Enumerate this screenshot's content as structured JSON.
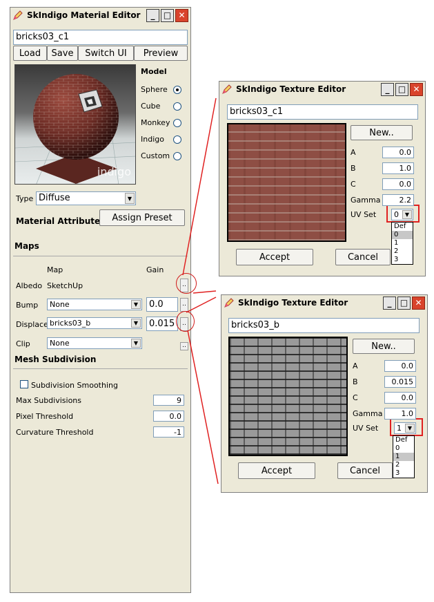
{
  "material_editor": {
    "title": "SkIndigo Material Editor",
    "material_name": "bricks03_c1",
    "buttons": {
      "load": "Load",
      "save": "Save",
      "switch_ui": "Switch UI",
      "preview": "Preview"
    },
    "preview_caption": "indigo",
    "model": {
      "heading": "Model",
      "options": [
        "Sphere",
        "Cube",
        "Monkey",
        "Indigo",
        "Custom"
      ],
      "selected": "Sphere"
    },
    "type_label": "Type",
    "type_value": "Diffuse",
    "material_attributes": "Material Attributes",
    "assign_preset": "Assign Preset",
    "maps": {
      "heading": "Maps",
      "col_map": "Map",
      "col_gain": "Gain",
      "rows": [
        {
          "label": "Albedo",
          "map": "SketchUp",
          "gain": ""
        },
        {
          "label": "Bump",
          "map": "None",
          "gain": "0.0"
        },
        {
          "label": "Displace",
          "map": "bricks03_b",
          "gain": "0.015"
        },
        {
          "label": "Clip",
          "map": "None",
          "gain": ""
        }
      ],
      "dots": ".."
    },
    "mesh_subdivision": {
      "heading": "Mesh Subdivision",
      "smoothing_label": "Subdivision Smoothing",
      "smoothing_checked": false,
      "fields": [
        {
          "label": "Max Subdivisions",
          "value": "9"
        },
        {
          "label": "Pixel Threshold",
          "value": "0.0"
        },
        {
          "label": "Curvature Threshold",
          "value": "-1"
        }
      ]
    }
  },
  "texture_editors": [
    {
      "title": "SkIndigo Texture Editor",
      "name": "bricks03_c1",
      "new_button": "New..",
      "fields": [
        {
          "label": "A",
          "value": "0.0"
        },
        {
          "label": "B",
          "value": "1.0"
        },
        {
          "label": "C",
          "value": "0.0"
        },
        {
          "label": "Gamma",
          "value": "2.2"
        }
      ],
      "uv_label": "UV Set",
      "uv_value": "0",
      "uv_options": [
        "Def",
        "0",
        "1",
        "2",
        "3"
      ],
      "uv_highlight": "0",
      "accept": "Accept",
      "cancel": "Cancel"
    },
    {
      "title": "SkIndigo Texture Editor",
      "name": "bricks03_b",
      "new_button": "New..",
      "fields": [
        {
          "label": "A",
          "value": "0.0"
        },
        {
          "label": "B",
          "value": "0.015"
        },
        {
          "label": "C",
          "value": "0.0"
        },
        {
          "label": "Gamma",
          "value": "1.0"
        }
      ],
      "uv_label": "UV Set",
      "uv_value": "1",
      "uv_options": [
        "Def",
        "0",
        "1",
        "2",
        "3"
      ],
      "uv_highlight": "1",
      "accept": "Accept",
      "cancel": "Cancel"
    }
  ],
  "window_controls": {
    "minimize": "_",
    "maximize": "□",
    "close": "✕"
  },
  "colors": {
    "annotation_red": "#e02020",
    "title_close": "#d9442c"
  }
}
